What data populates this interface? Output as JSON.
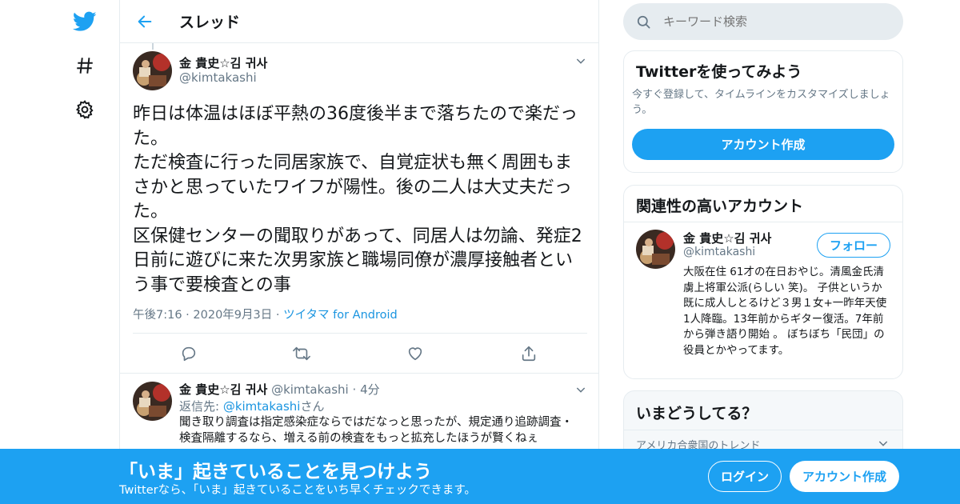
{
  "nav": {
    "icons": [
      "twitter-bird-icon",
      "hashtag-icon",
      "gear-icon"
    ]
  },
  "header": {
    "back_icon": "arrow-left-icon",
    "title": "スレッド"
  },
  "tweet": {
    "name": "金 貴史☆김 귀사",
    "handle": "@kimtakashi",
    "text": "昨日は体温はほぼ平熱の36度後半まで落ちたので楽だった。\nただ検査に行った同居家族で、自覚症状も無く周囲もまさかと思っていたワイフが陽性。後の二人は大丈夫だった。\n区保健センターの聞取りがあって、同居人は勿論、発症2日前に遊びに来た次男家族と職場同僚が濃厚接触者という事で要検査との事",
    "time": "午後7:16",
    "date": "2020年9月3日",
    "source": "ツイタマ for Android",
    "actions": [
      "reply-icon",
      "retweet-icon",
      "like-icon",
      "share-icon"
    ]
  },
  "reply": {
    "name": "金 貴史☆김 귀사",
    "handle": "@kimtakashi",
    "time": "4分",
    "reply_to_label": "返信先: ",
    "reply_to_handle": "@kimtakashi",
    "reply_to_suffix": "さん",
    "text": "聞き取り調査は指定感染症ならではだなっと思ったが、規定通り追跡調査・検査隔離するなら、増える前の検査をもっと拡充したほうが賢くねぇ"
  },
  "search": {
    "placeholder": "キーワード検索"
  },
  "signup_card": {
    "title": "Twitterを使ってみよう",
    "description": "今すぐ登録して、タイムラインをカスタマイズしましょう。",
    "button": "アカウント作成"
  },
  "related_card": {
    "title": "関連性の高いアカウント",
    "name": "金 貴史☆김 귀사",
    "handle": "@kimtakashi",
    "follow_button": "フォロー",
    "bio": "大阪在住 61才の在日おやじ。清風金氏清虜上将軍公派(らしい 笑)。 子供というか既に成人しとるけど３男１女+一昨年天使1人降臨。13年前からギター復活。7年前から弾き語り開始 。 ぼちぼち「民団」の役員とかやってます。"
  },
  "trends_card": {
    "title": "いまどうしてる？",
    "subtitle": "アメリカ合衆国のトレンド"
  },
  "bottom_bar": {
    "title": "「いま」起きていることを見つけよう",
    "subtitle": "Twitterなら、「いま」起きていることをいち早くチェックできます。",
    "login": "ログイン",
    "signup": "アカウント作成"
  },
  "colors": {
    "brand": "#1da1f2",
    "text": "#14171a",
    "muted": "#657786",
    "border": "#e6ecf0"
  }
}
